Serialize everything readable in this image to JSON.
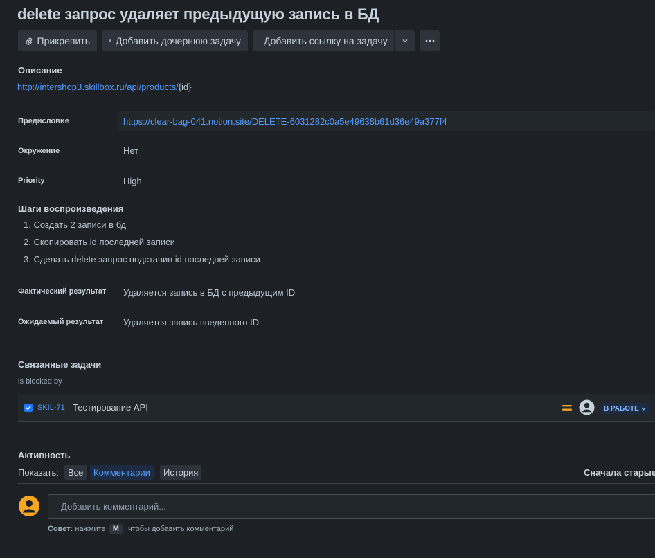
{
  "issue": {
    "title": "delete запрос удаляет предыдущую запись в БД"
  },
  "toolbar": {
    "attach_label": "Прикрепить",
    "child_label": "Добавить дочернюю задачу",
    "link_label": "Добавить ссылку на задачу"
  },
  "description": {
    "heading": "Описание",
    "url_link": "http://intershop3.skillbox.ru/api/products/",
    "url_suffix": "{id}"
  },
  "fields": {
    "preface_label": "Предисловие",
    "preface_value": "https://clear-bag-041.notion.site/DELETE-6031282c0a5e49638b61d36e49a377f4",
    "env_label": "Окружение",
    "env_value": "Нет",
    "priority_label": "Priority",
    "priority_value": "High"
  },
  "steps": {
    "heading": "Шаги воспроизведения",
    "items": [
      "1. Создать 2 записи в бд",
      "2. Скопировать id последней записи",
      "3. Сделать delete запрос подставив id последней записи"
    ]
  },
  "results": {
    "actual_label": "Фактический результат",
    "actual_value": "Удаляется запись в БД с предыдущим ID",
    "expected_label": "Ожидаемый результат",
    "expected_value": "Удаляется запись введенного ID"
  },
  "linked": {
    "heading": "Связанные задачи",
    "relation": "is blocked by",
    "items": [
      {
        "key": "SKIL-71",
        "summary": "Тестирование API",
        "status": "В РАБОТЕ"
      }
    ]
  },
  "activity": {
    "heading": "Активность",
    "show_label": "Показать:",
    "tabs": [
      "Все",
      "Комментарии",
      "История"
    ],
    "sort_label": "Сначала старые",
    "comment_placeholder": "Добавить комментарий...",
    "tip_prefix": "Совет:",
    "tip_pre": "нажмите",
    "tip_key": "M",
    "tip_post": ", чтобы добавить комментарий"
  },
  "colors": {
    "background": "#1d2125",
    "link": "#579dff",
    "priority_medium": "#f5a623",
    "avatar": "#f5a623",
    "status_bg": "#1c2b41"
  }
}
